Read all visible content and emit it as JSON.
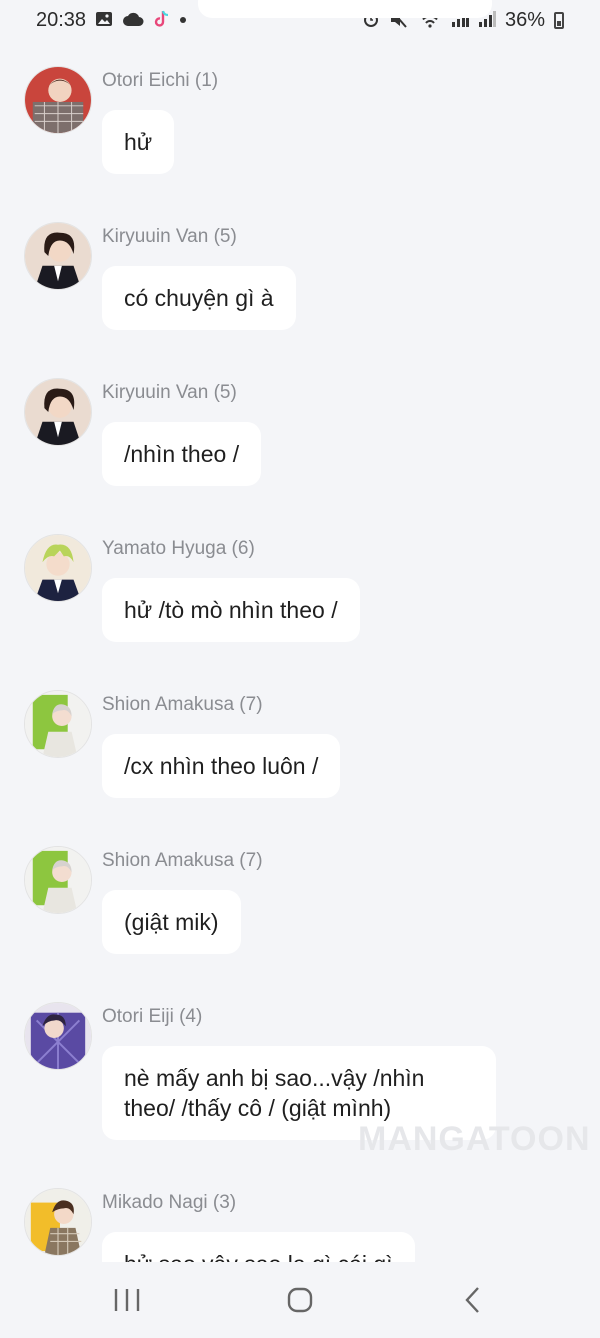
{
  "status_bar": {
    "time": "20:38",
    "battery": "36%"
  },
  "messages": [
    {
      "sender": "Otori Eichi (1)",
      "text": "hử",
      "avatar": "avatar-red-plaid"
    },
    {
      "sender": "Kiryuuin Van (5)",
      "text": "có chuyện gì à",
      "avatar": "avatar-dark-hair"
    },
    {
      "sender": "Kiryuuin Van (5)",
      "text": "/nhìn theo /",
      "avatar": "avatar-dark-hair"
    },
    {
      "sender": "Yamato Hyuga (6)",
      "text": "hử /tò mò nhìn theo /",
      "avatar": "avatar-green-hair"
    },
    {
      "sender": "Shion Amakusa (7)",
      "text": "/cx nhìn theo luôn /",
      "avatar": "avatar-lime-bg"
    },
    {
      "sender": "Shion Amakusa (7)",
      "text": "(giật mik)",
      "avatar": "avatar-lime-bg"
    },
    {
      "sender": "Otori Eiji (4)",
      "text": "nè mấy anh bị sao...vậy /nhìn theo/ /thấy cô / (giật mình)",
      "avatar": "avatar-purple"
    },
    {
      "sender": "Mikado Nagi (3)",
      "text": "hử sao vậy sao lạ gì cái gì",
      "avatar": "avatar-yellow"
    }
  ],
  "watermark": "MANGATOON",
  "colors": {
    "background": "#f4f5f8",
    "bubble": "#ffffff",
    "sender": "#8a8c91"
  }
}
